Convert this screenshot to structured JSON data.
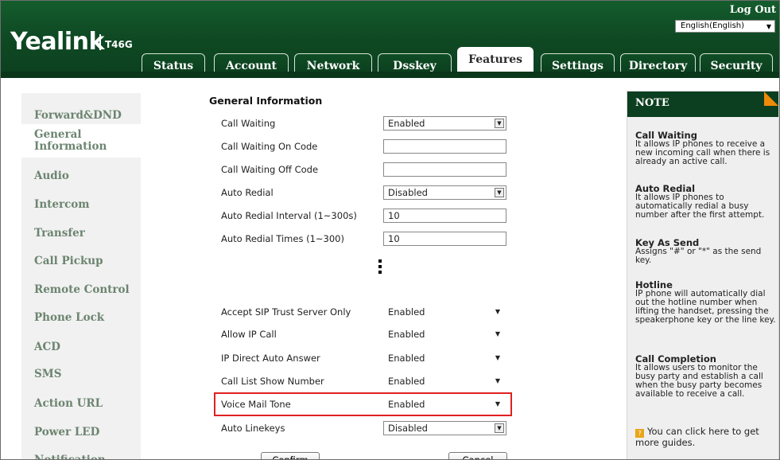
{
  "header": {
    "logo_text": "Yealink",
    "model": "T46G",
    "logout": "Log Out",
    "language": "English(English)"
  },
  "tabs": [
    {
      "label": "Status"
    },
    {
      "label": "Account"
    },
    {
      "label": "Network"
    },
    {
      "label": "Dsskey"
    },
    {
      "label": "Features",
      "active": true
    },
    {
      "label": "Settings"
    },
    {
      "label": "Directory"
    },
    {
      "label": "Security"
    }
  ],
  "sidebar": {
    "items": [
      {
        "label": "Forward&DND"
      },
      {
        "label": "General Information",
        "active": true
      },
      {
        "label": "Audio"
      },
      {
        "label": "Intercom"
      },
      {
        "label": "Transfer"
      },
      {
        "label": "Call Pickup"
      },
      {
        "label": "Remote Control"
      },
      {
        "label": "Phone Lock"
      },
      {
        "label": "ACD"
      },
      {
        "label": "SMS"
      },
      {
        "label": "Action URL"
      },
      {
        "label": "Power LED"
      },
      {
        "label": "Notification Popups"
      }
    ]
  },
  "main": {
    "section_title": "General Information",
    "rows": [
      {
        "label": "Call Waiting",
        "value": "Enabled",
        "type": "select"
      },
      {
        "label": "Call Waiting On Code",
        "value": "",
        "type": "text"
      },
      {
        "label": "Call Waiting Off Code",
        "value": "",
        "type": "text"
      },
      {
        "label": "Auto Redial",
        "value": "Disabled",
        "type": "select"
      },
      {
        "label": "Auto Redial Interval (1~300s)",
        "value": "10",
        "type": "text"
      },
      {
        "label": "Auto Redial Times (1~300)",
        "value": "10",
        "type": "text"
      },
      {
        "label": "Accept SIP Trust Server Only",
        "value": "Enabled",
        "type": "dropdown"
      },
      {
        "label": "Allow IP Call",
        "value": "Enabled",
        "type": "dropdown"
      },
      {
        "label": "IP Direct Auto Answer",
        "value": "Enabled",
        "type": "dropdown"
      },
      {
        "label": "Call List Show Number",
        "value": "Enabled",
        "type": "dropdown"
      },
      {
        "label": "Voice Mail Tone",
        "value": "Enabled",
        "type": "dropdown",
        "highlighted": true
      },
      {
        "label": "Auto Linekeys",
        "value": "Disabled",
        "type": "select"
      }
    ],
    "confirm_label": "Confirm",
    "cancel_label": "Cancel"
  },
  "note": {
    "heading": "NOTE",
    "blocks": [
      {
        "title": "Call Waiting",
        "text": "It allows IP phones to receive a new incoming call when there is already an active call."
      },
      {
        "title": "Auto Redial",
        "text": "It allows IP phones to automatically redial a busy number after the first attempt."
      },
      {
        "title": "Key As Send",
        "text": "Assigns \"#\" or \"*\" as the send key."
      },
      {
        "title": "Hotline",
        "text": "IP phone will automatically dial out the hotline number when lifting the handset, pressing the speakerphone key or the line key."
      },
      {
        "title": "Call Completion",
        "text": "It allows users to monitor the busy party and establish a call when the busy party becomes available to receive a call."
      }
    ],
    "guide_text": "You can click here to get more guides."
  },
  "colors": {
    "header_green": "#0c3f1f",
    "nav_text": "#6c8470",
    "note_corner": "#f08a0a",
    "highlight": "#e02020"
  }
}
